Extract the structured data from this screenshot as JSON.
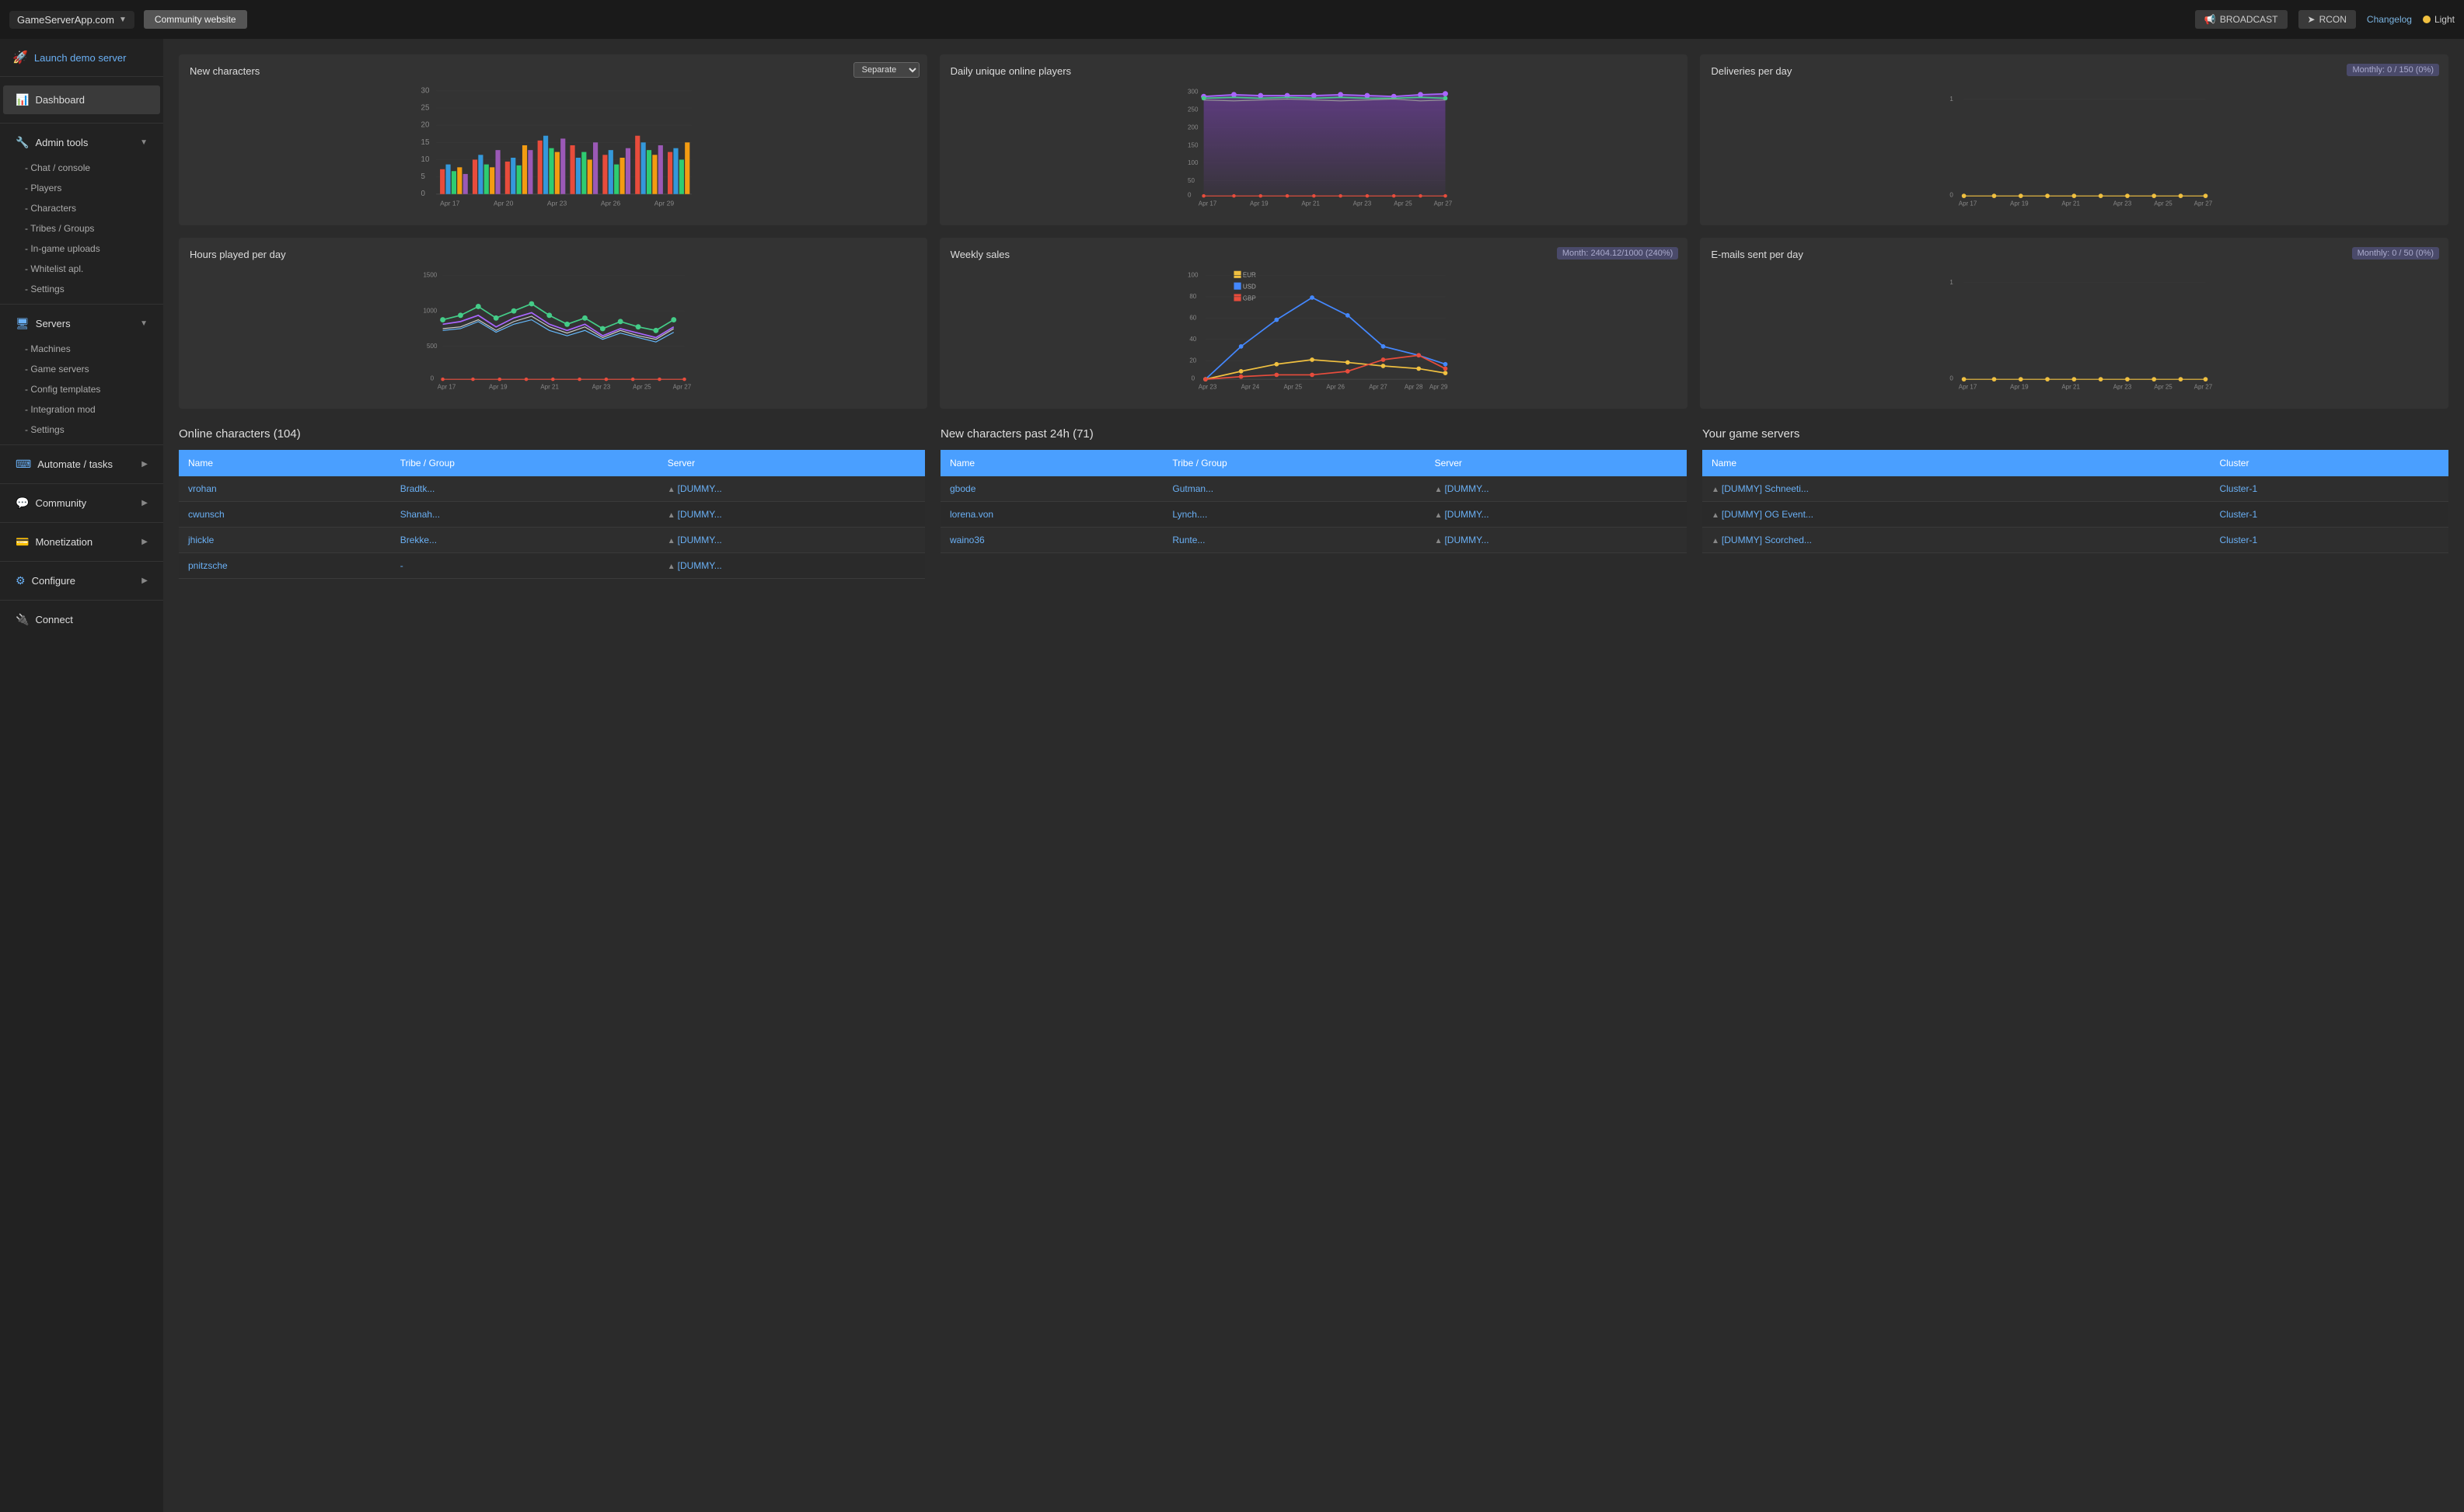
{
  "topnav": {
    "brand": "GameServerApp.com",
    "brand_arrow": "▼",
    "community_btn": "Community website",
    "broadcast_btn": "BROADCAST",
    "rcon_btn": "RCON",
    "changelog": "Changelog",
    "light": "Light"
  },
  "sidebar": {
    "launch": "Launch demo server",
    "dashboard": "Dashboard",
    "admin_tools": "Admin tools",
    "admin_sub": [
      "Chat / console",
      "Players",
      "Characters",
      "Tribes / Groups",
      "In-game uploads",
      "Whitelist apl.",
      "Settings"
    ],
    "servers": "Servers",
    "servers_sub": [
      "Machines",
      "Game servers",
      "Config templates",
      "Integration mod",
      "Settings"
    ],
    "automate": "Automate / tasks",
    "community": "Community",
    "monetization": "Monetization",
    "configure": "Configure",
    "connect": "Connect"
  },
  "charts": {
    "new_characters": {
      "title": "New characters",
      "select": "Separate",
      "x_labels": [
        "Apr 17",
        "Apr 20",
        "Apr 23",
        "Apr 26",
        "Apr 29"
      ],
      "y_labels": [
        "0",
        "5",
        "10",
        "15",
        "20",
        "25",
        "30"
      ]
    },
    "daily_players": {
      "title": "Daily unique online players",
      "y_labels": [
        "0",
        "50",
        "100",
        "150",
        "200",
        "250",
        "300"
      ],
      "x_labels": [
        "Apr 17",
        "Apr 19",
        "Apr 21",
        "Apr 23",
        "Apr 25",
        "Apr 27"
      ]
    },
    "deliveries": {
      "title": "Deliveries per day",
      "badge": "Monthly: 0 / 150 (0%)",
      "y_labels": [
        "0",
        "1"
      ],
      "x_labels": [
        "Apr 17",
        "Apr 19",
        "Apr 21",
        "Apr 23",
        "Apr 25",
        "Apr 27"
      ]
    },
    "hours_played": {
      "title": "Hours played per day",
      "y_labels": [
        "0",
        "500",
        "1000",
        "1500"
      ],
      "x_labels": [
        "Apr 17",
        "Apr 19",
        "Apr 21",
        "Apr 23",
        "Apr 25",
        "Apr 27"
      ]
    },
    "weekly_sales": {
      "title": "Weekly sales",
      "badge": "Month: 2404.12/1000 (240%)",
      "legend": [
        "EUR",
        "USD",
        "GBP"
      ],
      "y_labels": [
        "0",
        "20",
        "40",
        "60",
        "80",
        "100"
      ],
      "x_labels": [
        "Apr 23",
        "Apr 24",
        "Apr 25",
        "Apr 26",
        "Apr 27",
        "Apr 28",
        "Apr 29"
      ]
    },
    "emails": {
      "title": "E-mails sent per day",
      "badge": "Monthly: 0 / 50 (0%)",
      "y_labels": [
        "0",
        "1"
      ],
      "x_labels": [
        "Apr 17",
        "Apr 19",
        "Apr 21",
        "Apr 23",
        "Apr 25",
        "Apr 27"
      ]
    }
  },
  "online_characters": {
    "title": "Online characters (104)",
    "headers": [
      "Name",
      "Tribe / Group",
      "Server"
    ],
    "rows": [
      {
        "name": "vrohan",
        "tribe": "Bradtk...",
        "server": "[DUMMY..."
      },
      {
        "name": "cwunsch",
        "tribe": "Shanah...",
        "server": "[DUMMY..."
      },
      {
        "name": "jhickle",
        "tribe": "Brekke...",
        "server": "[DUMMY..."
      },
      {
        "name": "pnitzsche",
        "tribe": "-",
        "server": "[DUMMY..."
      }
    ]
  },
  "new_characters_24h": {
    "title": "New characters past 24h (71)",
    "headers": [
      "Name",
      "Tribe / Group",
      "Server"
    ],
    "rows": [
      {
        "name": "gbode",
        "tribe": "Gutman...",
        "server": "[DUMMY..."
      },
      {
        "name": "lorena.von",
        "tribe": "Lynch....",
        "server": "[DUMMY..."
      },
      {
        "name": "waino36",
        "tribe": "Runte...",
        "server": "[DUMMY..."
      }
    ]
  },
  "game_servers": {
    "title": "Your game servers",
    "headers": [
      "Name",
      "Cluster"
    ],
    "rows": [
      {
        "name": "[DUMMY] Schneeti...",
        "cluster": "Cluster-1"
      },
      {
        "name": "[DUMMY] OG Event...",
        "cluster": "Cluster-1"
      },
      {
        "name": "[DUMMY] Scorched...",
        "cluster": "Cluster-1"
      }
    ]
  }
}
